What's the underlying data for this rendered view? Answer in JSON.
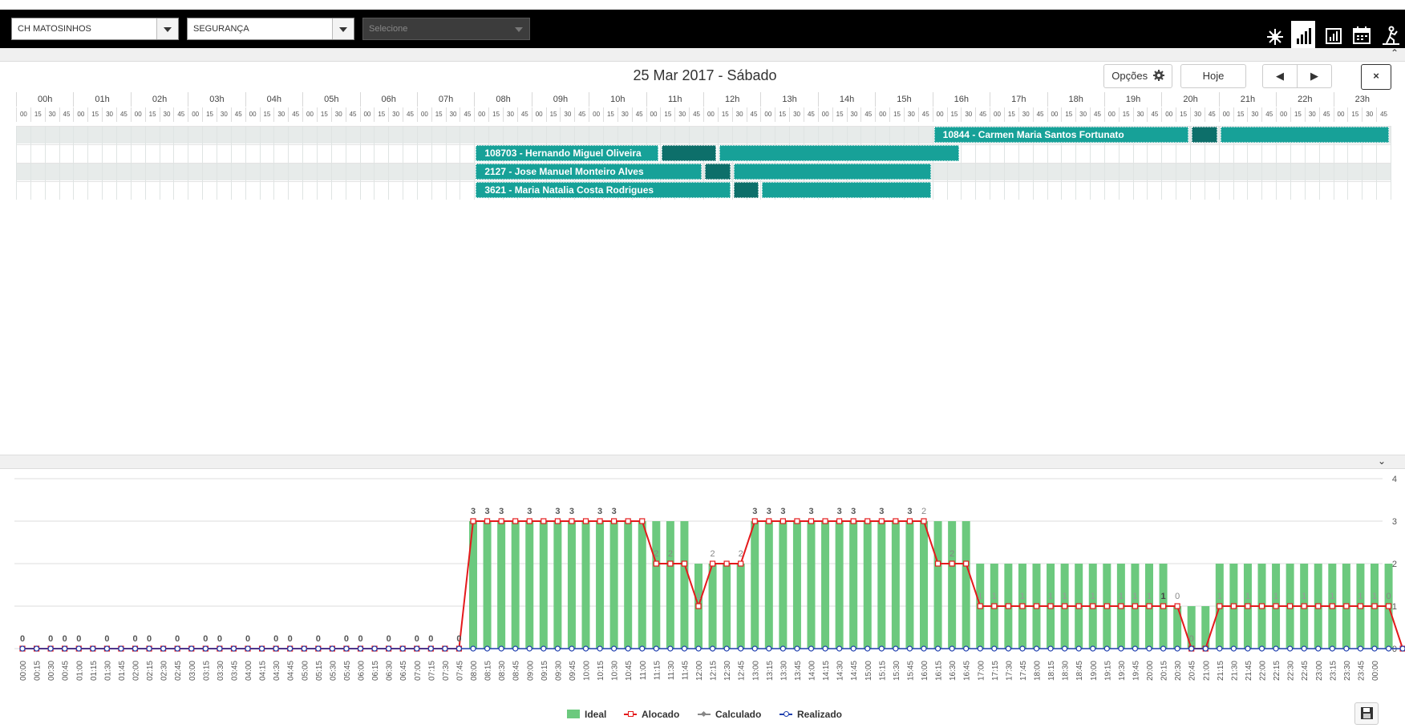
{
  "toolbar": {
    "location": "CH MATOSINHOS",
    "department": "SEGURANÇA",
    "select_placeholder": "Selecione",
    "icons": [
      "network-icon",
      "bar-chart-icon",
      "chart-panel-icon",
      "calendar-icon",
      "worker-icon"
    ],
    "active_icon": 1
  },
  "header": {
    "date_title": "25 Mar 2017 - Sábado",
    "options_label": "Opções",
    "today_label": "Hoje",
    "close_label": "×"
  },
  "timeline": {
    "hours": [
      "00h",
      "01h",
      "02h",
      "03h",
      "04h",
      "05h",
      "06h",
      "07h",
      "08h",
      "09h",
      "10h",
      "11h",
      "12h",
      "13h",
      "14h",
      "15h",
      "16h",
      "17h",
      "18h",
      "19h",
      "20h",
      "21h",
      "22h",
      "23h"
    ],
    "minutes": [
      "00",
      "15",
      "30",
      "45"
    ],
    "rows": [
      {
        "label": "10844 - Carmen Maria Santos Fortunato",
        "segments": [
          {
            "start": "16:00",
            "end": "20:30",
            "style": "main"
          },
          {
            "start": "20:30",
            "end": "21:00",
            "style": "dark"
          },
          {
            "start": "21:00",
            "end": "24:00",
            "style": "main"
          }
        ]
      },
      {
        "label": "108703 - Hernando Miguel Oliveira",
        "segments": [
          {
            "start": "08:00",
            "end": "11:15",
            "style": "main"
          },
          {
            "start": "11:15",
            "end": "12:15",
            "style": "dark"
          },
          {
            "start": "12:15",
            "end": "16:30",
            "style": "main"
          }
        ]
      },
      {
        "label": "2127 - Jose Manuel Monteiro Alves",
        "segments": [
          {
            "start": "08:00",
            "end": "12:00",
            "style": "main"
          },
          {
            "start": "12:00",
            "end": "12:30",
            "style": "dark"
          },
          {
            "start": "12:30",
            "end": "16:00",
            "style": "main"
          }
        ]
      },
      {
        "label": "3621 - Maria Natalia Costa Rodrigues",
        "segments": [
          {
            "start": "08:00",
            "end": "12:30",
            "style": "main"
          },
          {
            "start": "12:30",
            "end": "13:00",
            "style": "dark"
          },
          {
            "start": "13:00",
            "end": "16:00",
            "style": "main"
          }
        ]
      }
    ]
  },
  "chart_data": {
    "type": "bar",
    "x": [
      "00:00",
      "00:15",
      "00:30",
      "00:45",
      "01:00",
      "01:15",
      "01:30",
      "01:45",
      "02:00",
      "02:15",
      "02:30",
      "02:45",
      "03:00",
      "03:15",
      "03:30",
      "03:45",
      "04:00",
      "04:15",
      "04:30",
      "04:45",
      "05:00",
      "05:15",
      "05:30",
      "05:45",
      "06:00",
      "06:15",
      "06:30",
      "06:45",
      "07:00",
      "07:15",
      "07:30",
      "07:45",
      "08:00",
      "08:15",
      "08:30",
      "08:45",
      "09:00",
      "09:15",
      "09:30",
      "09:45",
      "10:00",
      "10:15",
      "10:30",
      "10:45",
      "11:00",
      "11:15",
      "11:30",
      "11:45",
      "12:00",
      "12:15",
      "12:30",
      "12:45",
      "13:00",
      "13:15",
      "13:30",
      "13:45",
      "14:00",
      "14:15",
      "14:30",
      "14:45",
      "15:00",
      "15:15",
      "15:30",
      "15:45",
      "16:00",
      "16:15",
      "16:30",
      "16:45",
      "17:00",
      "17:15",
      "17:30",
      "17:45",
      "18:00",
      "18:15",
      "18:30",
      "18:45",
      "19:00",
      "19:15",
      "19:30",
      "19:45",
      "20:00",
      "20:15",
      "20:30",
      "20:45",
      "21:00",
      "21:15",
      "21:30",
      "21:45",
      "22:00",
      "22:15",
      "22:30",
      "22:45",
      "23:00",
      "23:15",
      "23:30",
      "23:45",
      "00:00"
    ],
    "series": [
      {
        "name": "Ideal",
        "type": "bar",
        "color": "#6cc97e",
        "values": [
          0,
          0,
          0,
          0,
          0,
          0,
          0,
          0,
          0,
          0,
          0,
          0,
          0,
          0,
          0,
          0,
          0,
          0,
          0,
          0,
          0,
          0,
          0,
          0,
          0,
          0,
          0,
          0,
          0,
          0,
          0,
          0,
          3,
          3,
          3,
          3,
          3,
          3,
          3,
          3,
          3,
          3,
          3,
          3,
          3,
          3,
          3,
          3,
          2,
          2,
          2,
          2,
          3,
          3,
          3,
          3,
          3,
          3,
          3,
          3,
          3,
          3,
          3,
          3,
          3,
          3,
          3,
          3,
          2,
          2,
          2,
          2,
          2,
          2,
          2,
          2,
          2,
          2,
          2,
          2,
          2,
          2,
          1,
          1,
          1,
          2,
          2,
          2,
          2,
          2,
          2,
          2,
          2,
          2,
          2,
          2,
          2,
          2,
          0
        ]
      },
      {
        "name": "Alocado",
        "type": "line",
        "color": "#e41a1c",
        "values": [
          0,
          0,
          0,
          0,
          0,
          0,
          0,
          0,
          0,
          0,
          0,
          0,
          0,
          0,
          0,
          0,
          0,
          0,
          0,
          0,
          0,
          0,
          0,
          0,
          0,
          0,
          0,
          0,
          0,
          0,
          0,
          0,
          3,
          3,
          3,
          3,
          3,
          3,
          3,
          3,
          3,
          3,
          3,
          3,
          3,
          2,
          2,
          2,
          1,
          2,
          2,
          2,
          3,
          3,
          3,
          3,
          3,
          3,
          3,
          3,
          3,
          3,
          3,
          3,
          3,
          2,
          2,
          2,
          1,
          1,
          1,
          1,
          1,
          1,
          1,
          1,
          1,
          1,
          1,
          1,
          1,
          1,
          1,
          0,
          0,
          1,
          1,
          1,
          1,
          1,
          1,
          1,
          1,
          1,
          1,
          1,
          1,
          1,
          0
        ]
      },
      {
        "name": "Calculado",
        "type": "line",
        "color": "#888888",
        "values": []
      },
      {
        "name": "Realizado",
        "type": "line",
        "color": "#1f3fae",
        "values": [
          0,
          0,
          0,
          0,
          0,
          0,
          0,
          0,
          0,
          0,
          0,
          0,
          0,
          0,
          0,
          0,
          0,
          0,
          0,
          0,
          0,
          0,
          0,
          0,
          0,
          0,
          0,
          0,
          0,
          0,
          0,
          0,
          0,
          0,
          0,
          0,
          0,
          0,
          0,
          0,
          0,
          0,
          0,
          0,
          0,
          0,
          0,
          0,
          0,
          0,
          0,
          0,
          0,
          0,
          0,
          0,
          0,
          0,
          0,
          0,
          0,
          0,
          0,
          0,
          0,
          0,
          0,
          0,
          0,
          0,
          0,
          0,
          0,
          0,
          0,
          0,
          0,
          0,
          0,
          0,
          0,
          0,
          0,
          0,
          0,
          0,
          0,
          0,
          0,
          0,
          0,
          0,
          0,
          0,
          0,
          0,
          0,
          0,
          0
        ]
      }
    ],
    "ylim": [
      0,
      4
    ],
    "yticks": [
      0,
      1,
      2,
      3,
      4
    ],
    "label_marks": {
      "zero": [
        0,
        2,
        3,
        4,
        6,
        8,
        9,
        11,
        13,
        14,
        16,
        18,
        19,
        21,
        23,
        24,
        26,
        28,
        29,
        31
      ],
      "three": [
        32,
        33,
        34,
        36,
        38,
        39,
        41,
        42,
        52,
        53,
        54,
        56,
        58,
        59,
        61,
        63
      ],
      "two": [
        45,
        46,
        49,
        51,
        64,
        66
      ],
      "one": [
        48,
        68,
        69,
        71,
        73,
        74,
        76,
        78,
        79,
        80,
        85,
        87,
        89,
        91,
        93,
        95,
        96
      ],
      "one_bold": [
        81
      ],
      "zero_end": [
        82,
        83,
        97
      ]
    },
    "grid": true,
    "legend": "bottom"
  }
}
